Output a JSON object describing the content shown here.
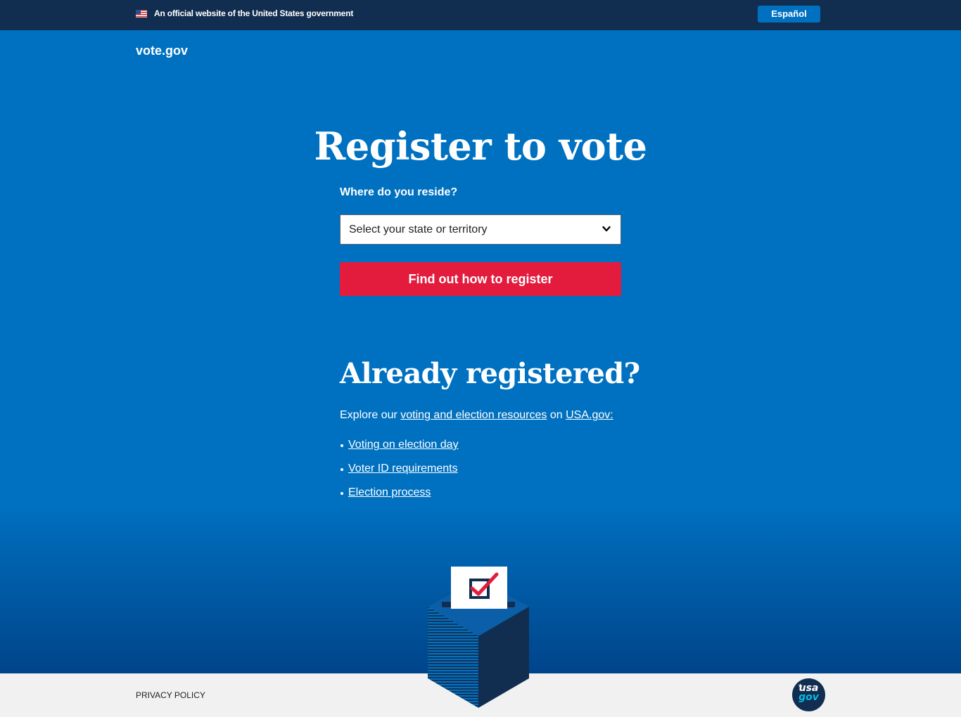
{
  "banner": {
    "official_text": "An official website of the United States government",
    "language_button": "Español"
  },
  "header": {
    "logo": "vote.gov"
  },
  "register": {
    "heading": "Register to vote",
    "reside_label": "Where do you reside?",
    "state_select_value": "Select your state or territory",
    "submit_button": "Find out how to register"
  },
  "already": {
    "heading": "Already registered?",
    "explore_prefix": "Explore our",
    "explore_link": "voting and election resources",
    "explore_middle": "on",
    "usagov_link": "USA.gov:",
    "resources": [
      "Voting on election day",
      "Voter ID requirements",
      "Election process"
    ]
  },
  "footer": {
    "privacy_link": "PRIVACY POLICY",
    "usagov_logo_top": "usa",
    "usagov_logo_bottom": "gov"
  },
  "colors": {
    "banner_bg": "#112e51",
    "hero_blue": "#0071c1",
    "cta_red": "#e31c3d",
    "footer_bg": "#f1f1f1"
  },
  "icons": [
    "us-flag-icon",
    "chevron-down-icon",
    "ballot-box-icon",
    "usagov-logo-icon"
  ]
}
